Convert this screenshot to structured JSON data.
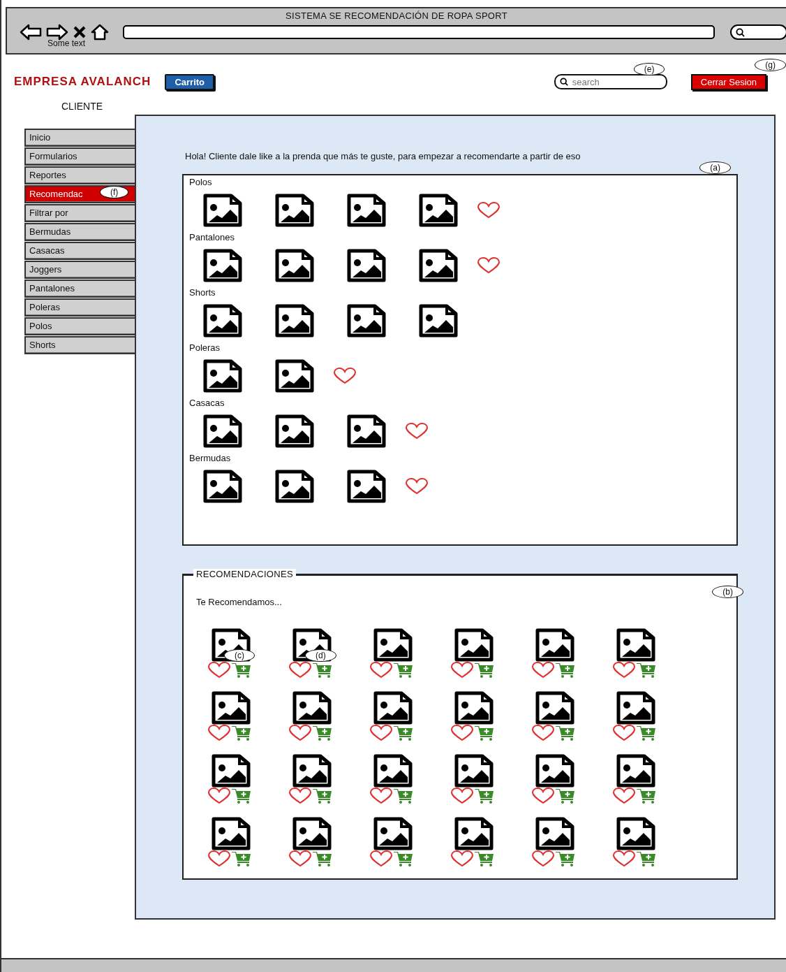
{
  "browser": {
    "title": "SISTEMA SE RECOMENDACIÓN DE ROPA SPORT",
    "overlay_text": "Some text"
  },
  "header": {
    "brand": "EMPRESA AVALANCH",
    "cart_button": "Carrito",
    "search": {
      "placeholder": "search",
      "callout": "(e)"
    },
    "logout_button": "Cerrar Sesion",
    "logout_callout": "(g)",
    "role": "CLIENTE"
  },
  "sidebar": {
    "items": [
      {
        "label": "Inicio",
        "selected": false
      },
      {
        "label": "Formularios",
        "selected": false
      },
      {
        "label": "Reportes",
        "selected": false
      },
      {
        "label": "Recomendac",
        "selected": true,
        "callout": "(f)"
      },
      {
        "label": "Filtrar por",
        "selected": false
      },
      {
        "label": "Bermudas",
        "selected": false
      },
      {
        "label": "Casacas",
        "selected": false
      },
      {
        "label": "Joggers",
        "selected": false
      },
      {
        "label": "Pantalones",
        "selected": false
      },
      {
        "label": "Poleras",
        "selected": false
      },
      {
        "label": "Polos",
        "selected": false
      },
      {
        "label": "Shorts",
        "selected": false
      }
    ]
  },
  "greeting": "Hola! Cliente dale like a la prenda que más te guste, para empezar a recomendarte a partir de eso",
  "catalog": {
    "callout": "(a)",
    "categories": [
      {
        "name": "Polos",
        "like_button": true,
        "products": [
          {
            "kind": "picture"
          },
          {
            "kind": "picture"
          },
          {
            "kind": "picture"
          },
          {
            "kind": "picture"
          }
        ]
      },
      {
        "name": "Pantalones",
        "like_button": true,
        "products": [
          {
            "kind": "picture"
          },
          {
            "kind": "picture"
          },
          {
            "kind": "picture"
          },
          {
            "kind": "picture"
          }
        ]
      },
      {
        "name": "Shorts",
        "like_button": false,
        "products": [
          {
            "kind": "picture"
          },
          {
            "kind": "picture"
          },
          {
            "kind": "picture"
          },
          {
            "kind": "picture"
          }
        ]
      },
      {
        "name": "Poleras",
        "like_button": true,
        "products": [
          {
            "kind": "picture"
          },
          {
            "kind": "picture"
          }
        ]
      },
      {
        "name": "Casacas",
        "like_button": true,
        "products": [
          {
            "kind": "picture"
          },
          {
            "kind": "picture"
          },
          {
            "kind": "picture"
          }
        ]
      },
      {
        "name": "Bermudas",
        "like_button": true,
        "products": [
          {
            "kind": "picture"
          },
          {
            "kind": "picture"
          },
          {
            "kind": "picture"
          }
        ]
      }
    ]
  },
  "recommendations": {
    "title": "RECOMENDACIONES",
    "subtitle": "Te Recomendamos...",
    "callout": "(b)",
    "items": [
      {
        "kind": "picture",
        "callout": "(c)"
      },
      {
        "kind": "picture",
        "callout": "(d)"
      },
      {
        "kind": "picture"
      },
      {
        "kind": "picture"
      },
      {
        "kind": "picture"
      },
      {
        "kind": "picture"
      },
      {
        "kind": "picture"
      },
      {
        "kind": "picture"
      },
      {
        "kind": "picture"
      },
      {
        "kind": "picture"
      },
      {
        "kind": "picture"
      },
      {
        "kind": "picture"
      },
      {
        "kind": "picture"
      },
      {
        "kind": "picture"
      },
      {
        "kind": "picture"
      },
      {
        "kind": "picture"
      },
      {
        "kind": "picture"
      },
      {
        "kind": "picture"
      },
      {
        "kind": "picture"
      },
      {
        "kind": "picture"
      },
      {
        "kind": "picture"
      },
      {
        "kind": "picture"
      },
      {
        "kind": "picture"
      },
      {
        "kind": "picture"
      }
    ]
  }
}
